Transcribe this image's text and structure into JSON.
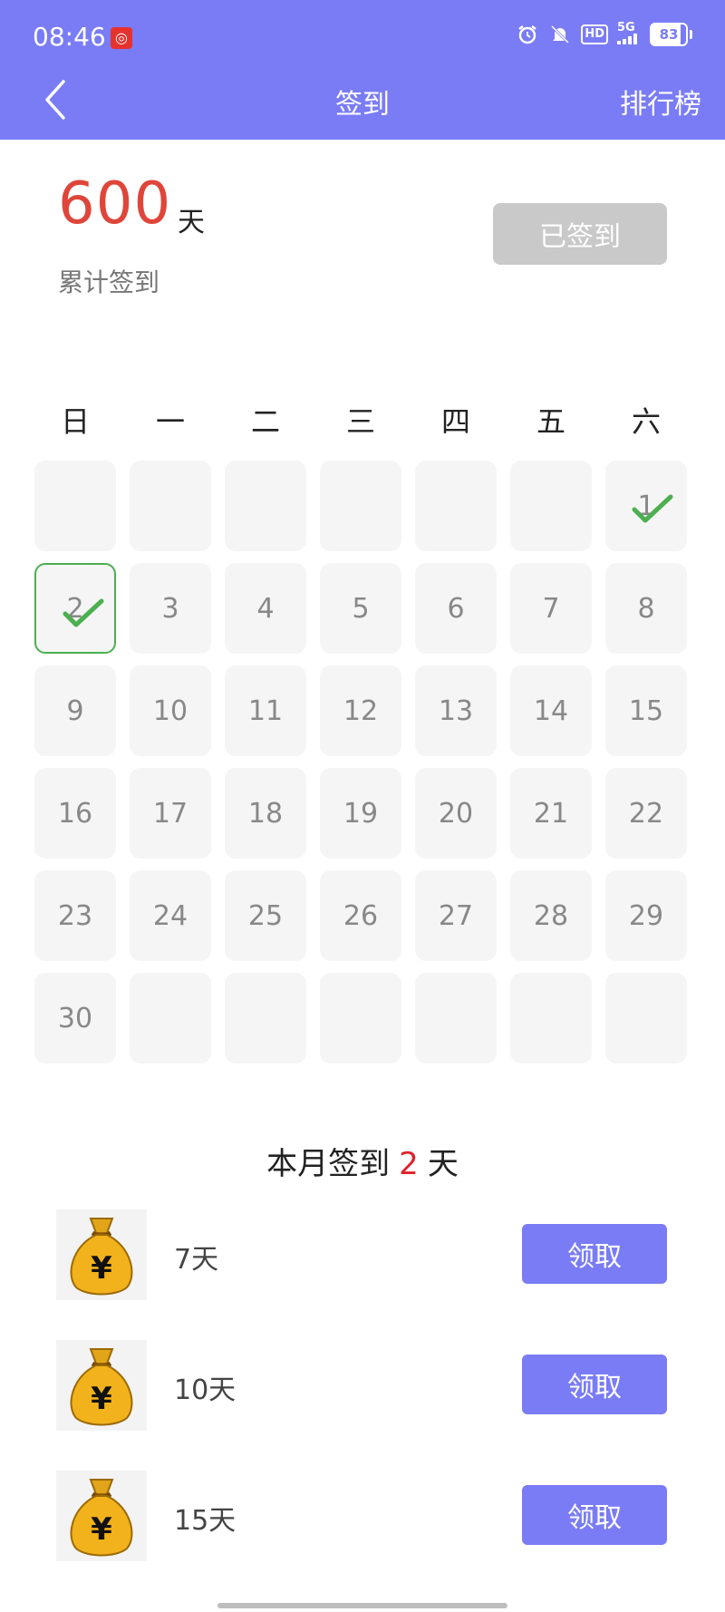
{
  "status": {
    "time": "08:46",
    "hd": "HD",
    "network": "5G",
    "battery": "83",
    "battery_level": 0.83,
    "icons": [
      "netease-music-icon",
      "alarm-icon",
      "mute-icon",
      "hd-icon",
      "signal-icon",
      "battery-icon"
    ]
  },
  "nav": {
    "title": "签到",
    "right": "排行榜"
  },
  "summary": {
    "total_days": "600",
    "unit": "天",
    "label": "累计签到",
    "signed_button": "已签到"
  },
  "calendar": {
    "weekdays": [
      "日",
      "一",
      "二",
      "三",
      "四",
      "五",
      "六"
    ],
    "days": [
      "",
      "",
      "",
      "",
      "",
      "",
      "1",
      "2",
      "3",
      "4",
      "5",
      "6",
      "7",
      "8",
      "9",
      "10",
      "11",
      "12",
      "13",
      "14",
      "15",
      "16",
      "17",
      "18",
      "19",
      "20",
      "21",
      "22",
      "23",
      "24",
      "25",
      "26",
      "27",
      "28",
      "29",
      "30",
      "",
      "",
      "",
      "",
      "",
      ""
    ],
    "checked_days": [
      "1",
      "2"
    ],
    "today": "2"
  },
  "month": {
    "prefix": "本月签到",
    "count": "2",
    "suffix": "天"
  },
  "rewards": [
    {
      "label": "7天",
      "button": "领取"
    },
    {
      "label": "10天",
      "button": "领取"
    },
    {
      "label": "15天",
      "button": "领取"
    }
  ],
  "colors": {
    "accent": "#7a7cf5",
    "highlight": "#e0453a",
    "check": "#4caf50",
    "disabled": "#c9c9c9"
  }
}
